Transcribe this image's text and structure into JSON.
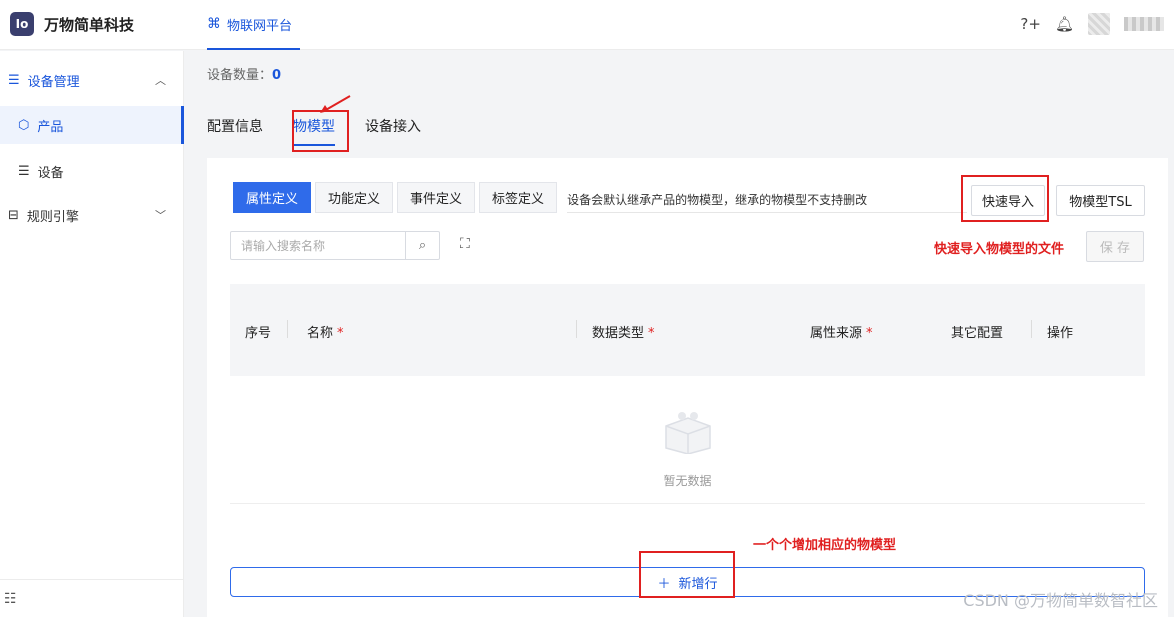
{
  "header": {
    "logo_mark": "Io",
    "brand": "万物简单科技",
    "platform_label": "物联网平台",
    "help_label": "?+"
  },
  "sidebar": {
    "items": [
      {
        "label": "设备管理",
        "icon": "list-icon",
        "chevron": "^"
      },
      {
        "label": "产品",
        "icon": "cube-icon"
      },
      {
        "label": "设备",
        "icon": "list-icon"
      },
      {
        "label": "规则引擎",
        "icon": "rule-icon",
        "chevron": "v"
      }
    ],
    "collapse_icon": "menu-fold-icon"
  },
  "main": {
    "device_count_label": "设备数量：",
    "device_count": "0",
    "tabs": [
      "配置信息",
      "物模型",
      "设备接入"
    ],
    "active_tab": "物模型",
    "subtabs": [
      "属性定义",
      "功能定义",
      "事件定义",
      "标签定义"
    ],
    "subtab_note": "设备会默认继承产品的物模型，继承的物模型不支持删改",
    "quick_import_label": "快速导入",
    "tsl_label": "物模型TSL",
    "search_placeholder": "请输入搜索名称",
    "quick_import_note": "快速导入物模型的文件",
    "save_label": "保 存",
    "columns": [
      "序号",
      "名称",
      "数据类型",
      "属性来源",
      "其它配置",
      "操作"
    ],
    "empty_text": "暂无数据",
    "add_note": "一个个增加相应的物模型",
    "add_row_label": "新增行"
  },
  "watermark": "CSDN @万物简单数智社区",
  "colors": {
    "accent": "#1a56db",
    "annotation": "#e02020"
  }
}
